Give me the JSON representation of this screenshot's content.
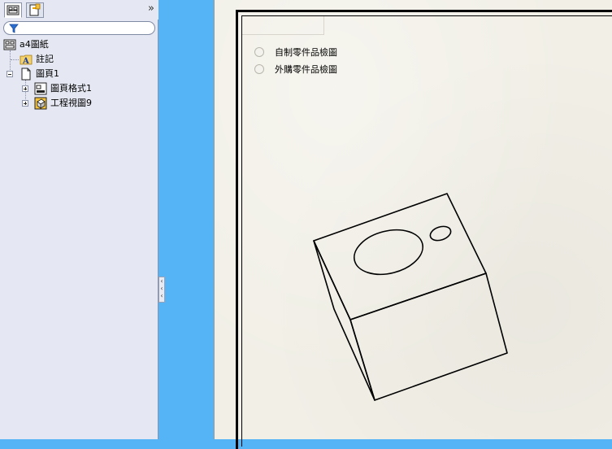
{
  "tree_panel": {
    "tabs": [
      {
        "name": "feature-tree",
        "active": true
      },
      {
        "name": "property-manager",
        "active": false
      }
    ],
    "collapse_glyph": "»",
    "filter_icon": "filter-funnel-icon",
    "items": [
      {
        "label": "a4圖紙",
        "icon": "drawing-icon"
      },
      {
        "label": "註記",
        "icon": "annotations-folder-icon"
      },
      {
        "label": "圖頁1",
        "icon": "sheet-icon"
      },
      {
        "label": "圖頁格式1",
        "icon": "sheet-format-icon"
      },
      {
        "label": "工程視圖9",
        "icon": "drawing-view-icon"
      }
    ]
  },
  "drawing": {
    "options": [
      {
        "label": "自制零件品檢圖",
        "selected": false
      },
      {
        "label": "外購零件品檢圖",
        "selected": false
      }
    ]
  },
  "colors": {
    "background": "#55b4f6",
    "panel": "#e5e8f2",
    "sheet": "#f1efe6"
  }
}
